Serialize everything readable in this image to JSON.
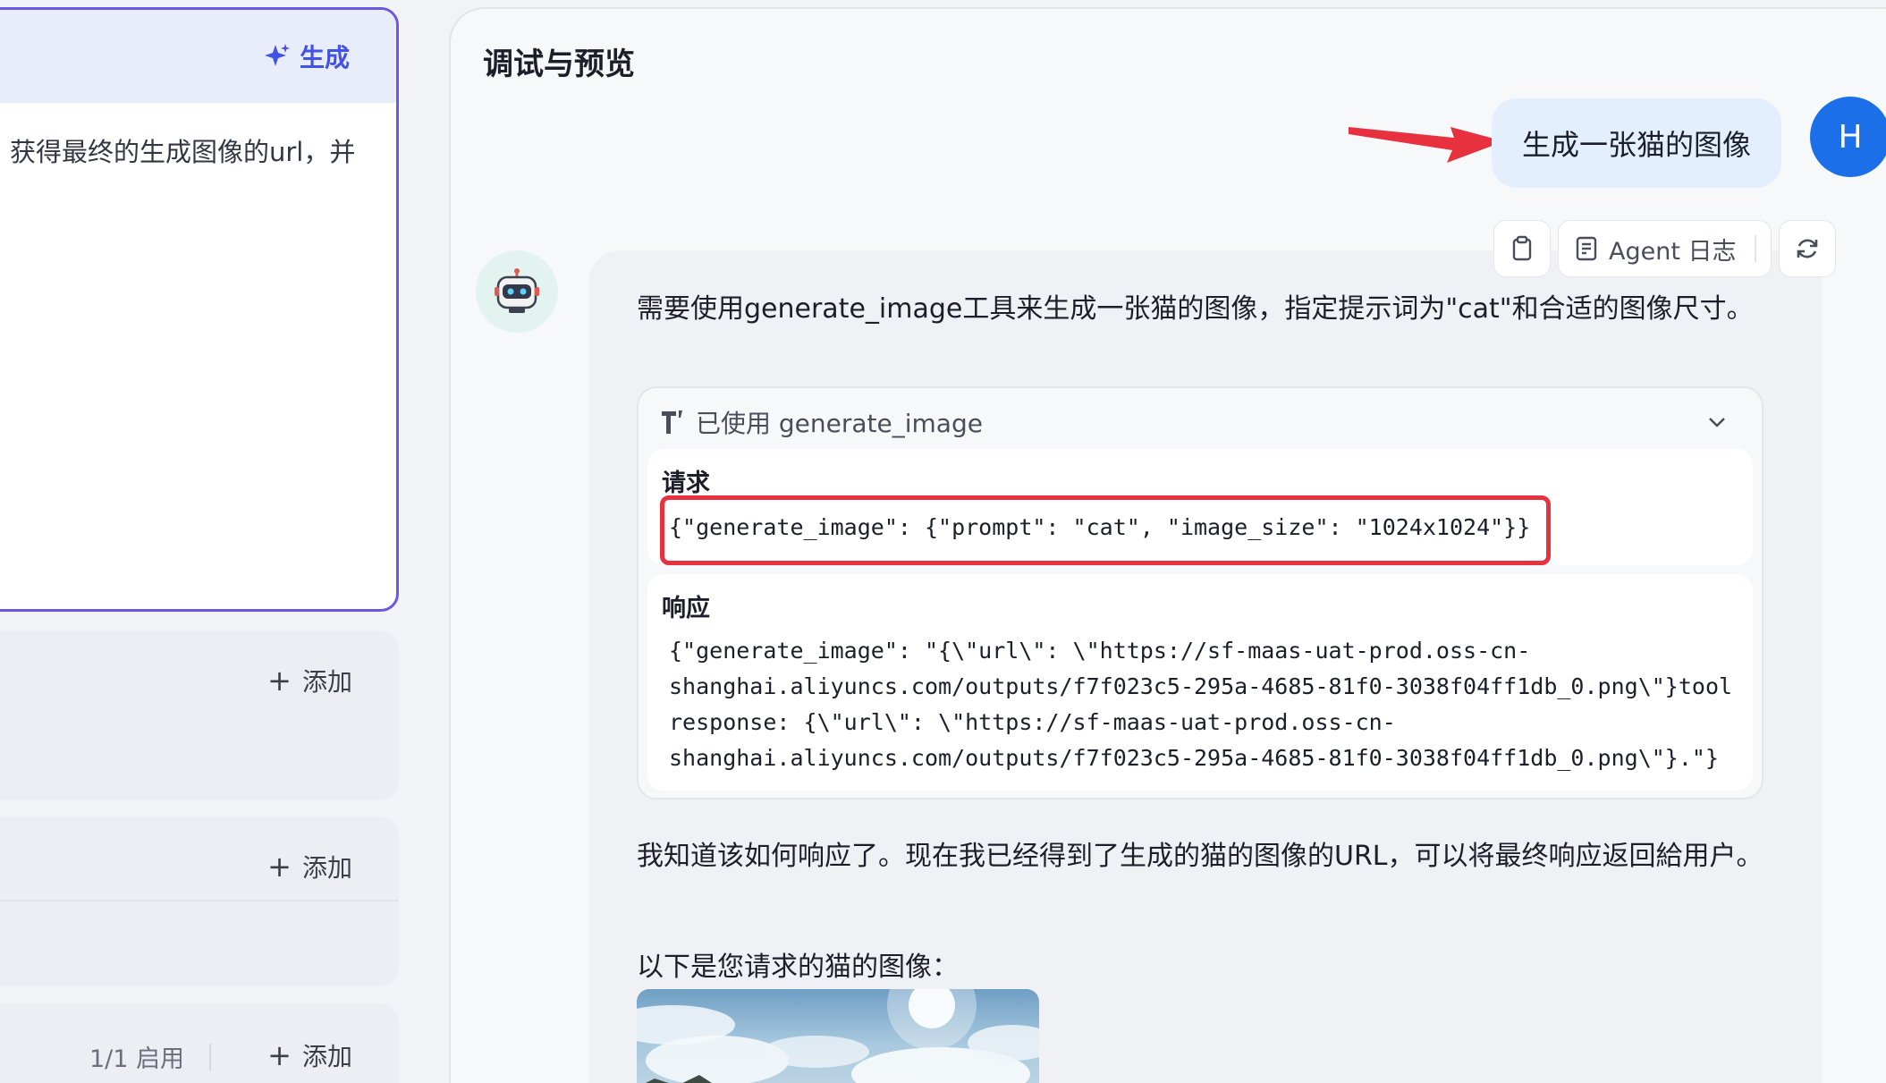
{
  "left": {
    "prompt_card": {
      "generate_label": "生成",
      "text": "获得最终的生成图像的url，并"
    },
    "cards": [
      {
        "add_label": "添加"
      },
      {
        "add_label": "添加"
      },
      {
        "enabled_label": "1/1 启用",
        "add_label": "添加"
      }
    ]
  },
  "panel": {
    "title": "调试与预览",
    "user_message": "生成一张猫的图像",
    "user_avatar": "H",
    "toolbar": {
      "agent_log_label": "Agent 日志",
      "icons": [
        "clipboard-icon",
        "document-icon",
        "refresh-icon"
      ]
    },
    "bot": {
      "text1": "需要使用generate_image工具来生成一张猫的图像，指定提示词为\"cat\"和合适的图像尺寸。",
      "tool_used": "已使用 generate_image",
      "request_label": "请求",
      "request_code": "{\"generate_image\": {\"prompt\": \"cat\", \"image_size\": \"1024x1024\"}}",
      "response_label": "响应",
      "response_code_lines": [
        "{\"generate_image\": \"{\\\"url\\\": \\\"https://sf-maas-uat-prod.oss-cn-",
        "shanghai.aliyuncs.com/outputs/f7f023c5-295a-4685-81f0-3038f04ff1db_0.png\\\"}tool",
        "response: {\\\"url\\\": \\\"https://sf-maas-uat-prod.oss-cn-",
        "shanghai.aliyuncs.com/outputs/f7f023c5-295a-4685-81f0-3038f04ff1db_0.png\\\"}.\"}"
      ],
      "text2": "我知道该如何响应了。现在我已经得到了生成的猫的图像的URL，可以将最终响应返回給用户。",
      "text3": "以下是您请求的猫的图像："
    }
  },
  "colors": {
    "accent": "#4352e6",
    "card_border": "#6b57e2",
    "annotation_red": "#e8313f",
    "user_avatar": "#1b6fe8",
    "user_bubble": "#e3effc"
  }
}
